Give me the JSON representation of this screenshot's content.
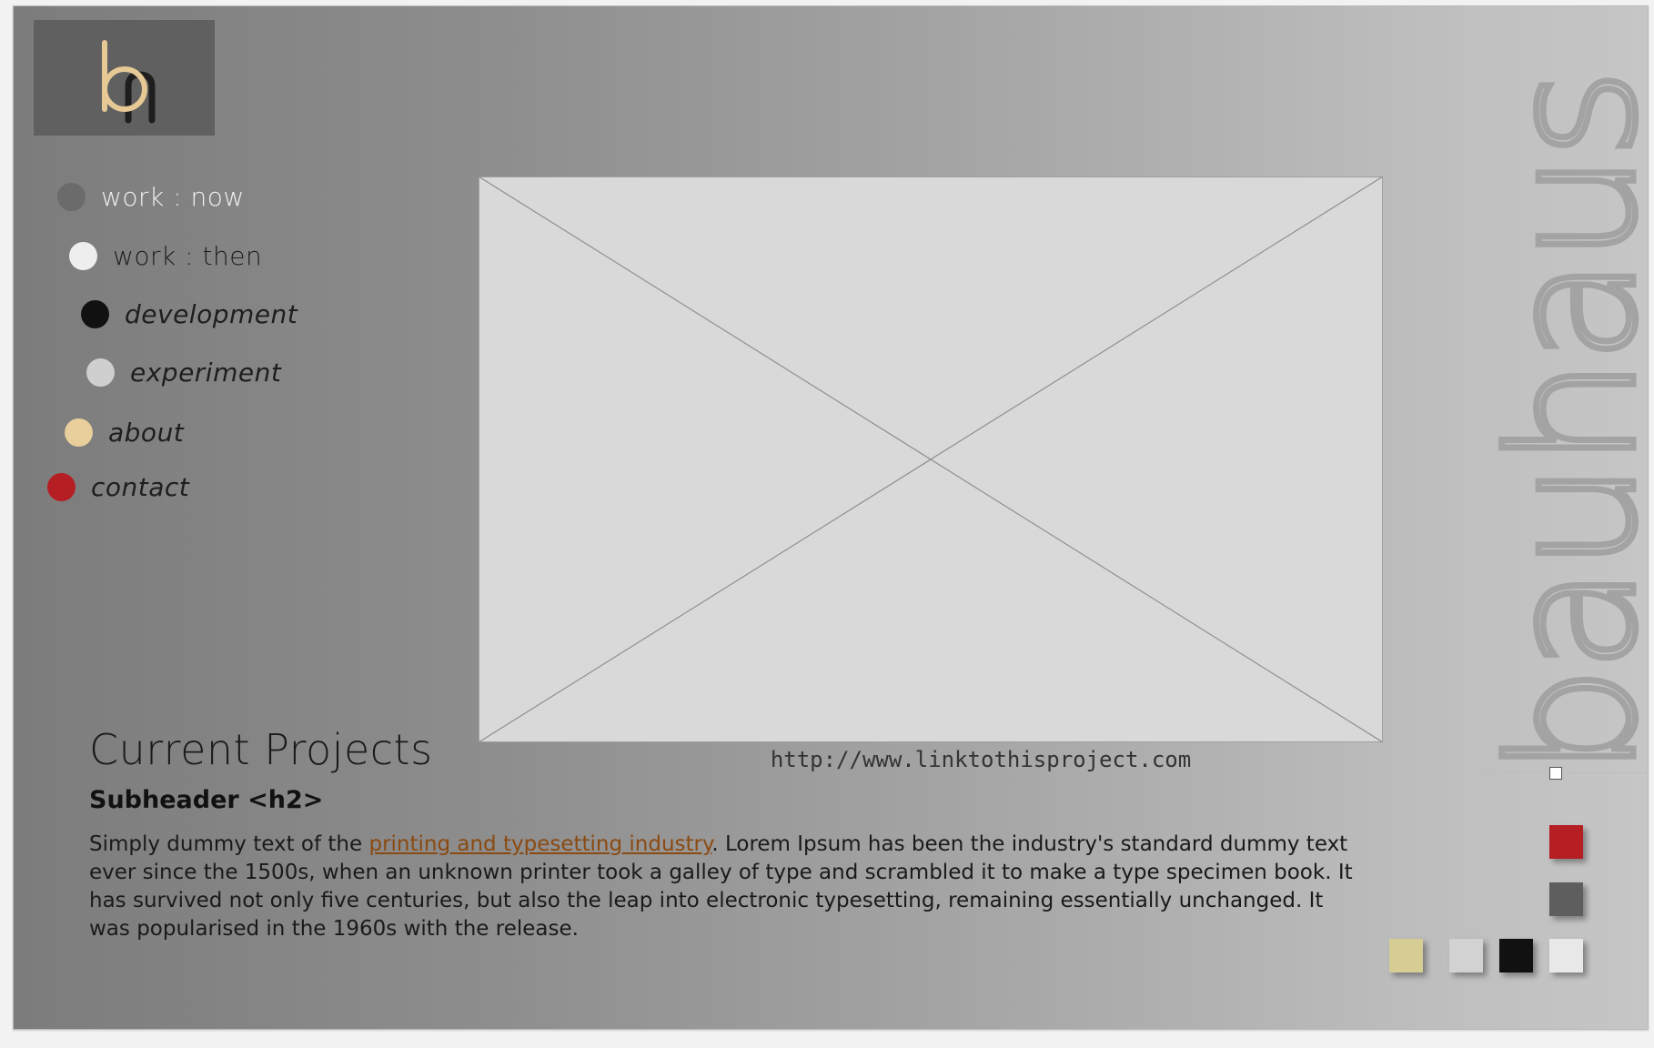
{
  "colors": {
    "nav_now": "#6b6b6b",
    "nav_then": "#eeeeee",
    "nav_development": "#111111",
    "nav_experiment": "#cfcfcf",
    "nav_about": "#e8cf9c",
    "nav_contact": "#b51f24",
    "logo_letter_b": "#e6c994",
    "logo_letter_n": "#1e1e1e",
    "link": "#8a4a12",
    "swatches": [
      "#b51f24",
      "#5e5e5e",
      "#d6cd95",
      "#d2d2d2",
      "#111111",
      "#e8e8e8"
    ]
  },
  "logo": {
    "icon": "logo-bh-icon"
  },
  "nav": {
    "items": [
      {
        "label": "work : now"
      },
      {
        "label": "work : then"
      },
      {
        "label": "development"
      },
      {
        "label": "experiment"
      },
      {
        "label": "about"
      },
      {
        "label": "contact"
      }
    ]
  },
  "main": {
    "image_icon": "image-placeholder-icon",
    "project_link": "http://www.linktothisproject.com",
    "title": "Current Projects",
    "subheader": "Subheader <h2>",
    "body_before_link": "Simply dummy text of the ",
    "body_link": "printing and typesetting industry",
    "body_after_link": ". Lorem Ipsum has been the industry's standard dummy text ever since the 1500s, when an unknown printer took a galley of type and scrambled it to make a type specimen book. It has survived not only five centuries, but also the leap into electronic typesetting, remaining essentially unchanged. It was popularised in the 1960s with the release."
  },
  "side": {
    "vertical_word": "bauhaus"
  }
}
